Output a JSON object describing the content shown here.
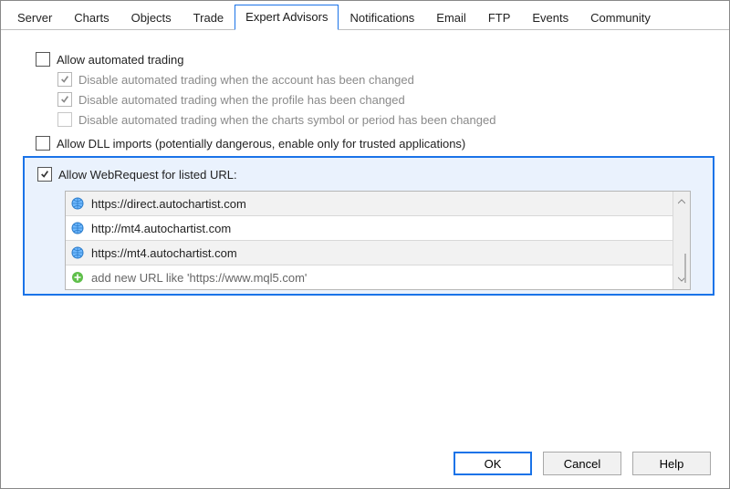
{
  "tabs": {
    "items": [
      "Server",
      "Charts",
      "Objects",
      "Trade",
      "Expert Advisors",
      "Notifications",
      "Email",
      "FTP",
      "Events",
      "Community"
    ],
    "activeIndex": 4
  },
  "options": {
    "allow_auto_trading": "Allow automated trading",
    "disable_on_account": "Disable automated trading when the account has been changed",
    "disable_on_profile": "Disable automated trading when the profile has been changed",
    "disable_on_symbol": "Disable automated trading when the charts symbol or period has been changed",
    "allow_dll": "Allow DLL imports (potentially dangerous, enable only for trusted applications)",
    "allow_webrequest": "Allow WebRequest for listed URL:"
  },
  "urls": {
    "items": [
      "https://direct.autochartist.com",
      "http://mt4.autochartist.com",
      "https://mt4.autochartist.com"
    ],
    "add_placeholder": "add new URL like 'https://www.mql5.com'"
  },
  "buttons": {
    "ok": "OK",
    "cancel": "Cancel",
    "help": "Help"
  }
}
